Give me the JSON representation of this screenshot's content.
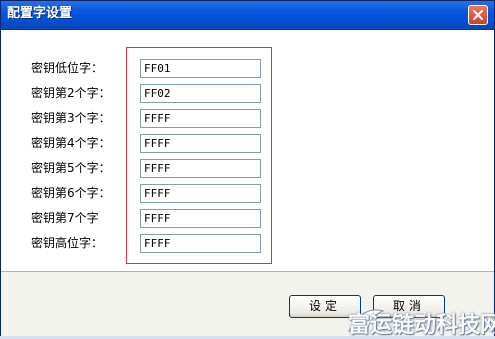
{
  "window": {
    "title": "配置字设置"
  },
  "fields": [
    {
      "label": "密钥低位字：",
      "value": "FF01"
    },
    {
      "label": "密钥第2个字：",
      "value": "FF02"
    },
    {
      "label": "密钥第3个字：",
      "value": "FFFF"
    },
    {
      "label": "密钥第4个字：",
      "value": "FFFF"
    },
    {
      "label": "密钥第5个字：",
      "value": "FFFF"
    },
    {
      "label": "密钥第6个字：",
      "value": "FFFF"
    },
    {
      "label": "密钥第7个字",
      "value": "FFFF"
    },
    {
      "label": "密钥高位字：",
      "value": "FFFF"
    }
  ],
  "buttons": {
    "ok": "设定",
    "cancel": "取消"
  },
  "watermark": {
    "text": "富运链动科技网"
  },
  "colors": {
    "highlight": "#e0303a",
    "titlebar": "#0a58e0"
  }
}
